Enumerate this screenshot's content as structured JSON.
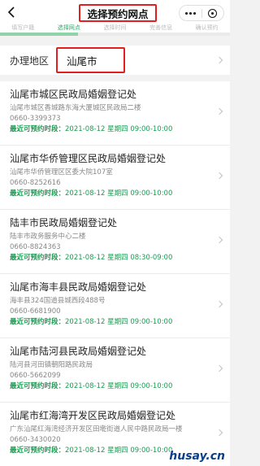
{
  "navbar": {
    "title": "选择预约网点"
  },
  "steps": [
    {
      "label": "填写户籍"
    },
    {
      "label": "选择网点",
      "active": true
    },
    {
      "label": "选择时间"
    },
    {
      "label": "完善信息"
    },
    {
      "label": "确认预约"
    }
  ],
  "region": {
    "label": "办理地区",
    "value": "汕尾市"
  },
  "slot_label": "最近可预约时段：",
  "offices": [
    {
      "name": "汕尾市城区民政局婚姻登记处",
      "address": "汕尾市城区香城路东海大厦城区民政局二楼",
      "phone": "0660-3399373",
      "slot": "2021-08-12 星期四 09:00-10:00"
    },
    {
      "name": "汕尾市华侨管理区民政局婚姻登记处",
      "address": "汕尾市华侨管理区区委大院107室",
      "phone": "0660-8252616",
      "slot": "2021-08-12 星期四 09:00-10:00"
    },
    {
      "name": "陆丰市民政局婚姻登记处",
      "address": "陆丰市政务服务中心二楼",
      "phone": "0660-8824363",
      "slot": "2021-08-12 星期四 08:30-09:00"
    },
    {
      "name": "汕尾市海丰县民政局婚姻登记处",
      "address": "海丰县324国道县城西段488号",
      "phone": "0660-6681900",
      "slot": "2021-08-12 星期四 09:00-10:00"
    },
    {
      "name": "汕尾市陆河县民政局婚姻登记处",
      "address": "陆河县河田镇朝阳路民政局",
      "phone": "0660-5662099",
      "slot": "2021-08-12 星期四 09:00-10:00"
    },
    {
      "name": "汕尾市红海湾开发区民政局婚姻登记处",
      "address": "广东汕尾红海湾经济开发区田墘街道人民中路民政局一楼",
      "phone": "0660-3430020",
      "slot": "2021-08-12 星期四 09:00-10:00"
    }
  ],
  "watermark": "husay.cn"
}
